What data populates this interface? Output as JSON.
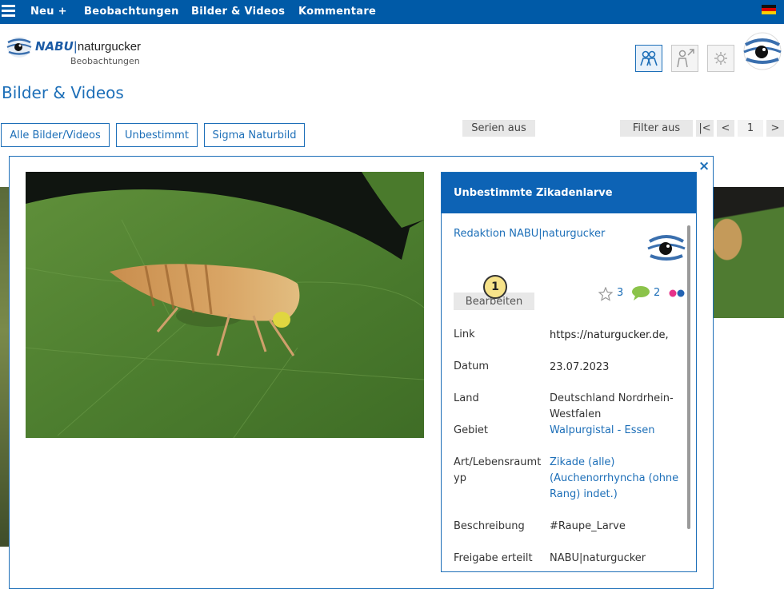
{
  "topnav": {
    "items": [
      "Neu +",
      "Beobachtungen",
      "Bilder & Videos",
      "Kommentare"
    ]
  },
  "logo": {
    "brand": "NABU",
    "separator": "|",
    "name": "naturgucker",
    "subtitle": "Beobachtungen"
  },
  "page": {
    "title": "Bilder & Videos"
  },
  "filters": {
    "buttons": [
      "Alle Bilder/Videos",
      "Unbestimmt",
      "Sigma Naturbild"
    ],
    "series_label": "Serien aus",
    "filter_label": "Filter aus"
  },
  "pagination": {
    "first": "|<",
    "prev": "<",
    "page": "1",
    "next": ">"
  },
  "modal": {
    "close": "×",
    "panel": {
      "title": "Unbestimmte Zikadenlarve",
      "user": "Redaktion NABU|naturgucker",
      "edit_label": "Bearbeiten",
      "badge": "1",
      "stars": "3",
      "comments": "2",
      "fields": [
        {
          "label": "Link",
          "value": "https://naturgucker.de,"
        },
        {
          "label": "Datum",
          "value": "23.07.2023"
        },
        {
          "label": "Land",
          "value": "Deutschland Nordrhein-Westfalen"
        },
        {
          "label": "Gebiet",
          "value": "Walpurgistal - Essen"
        },
        {
          "label": "Art/Lebensraumtyp",
          "value": "Zikade (alle) (Auchenorrhyncha (ohne Rang) indet.)"
        },
        {
          "label": "Beschreibung",
          "value": "#Raupe_Larve"
        },
        {
          "label": "Freigabe erteilt",
          "value": "NABU|naturgucker"
        }
      ]
    }
  },
  "colors": {
    "nav": "#005aa7",
    "accent": "#1d6fb8",
    "panel_header": "#0d63b5",
    "badge": "#f7e38a"
  }
}
